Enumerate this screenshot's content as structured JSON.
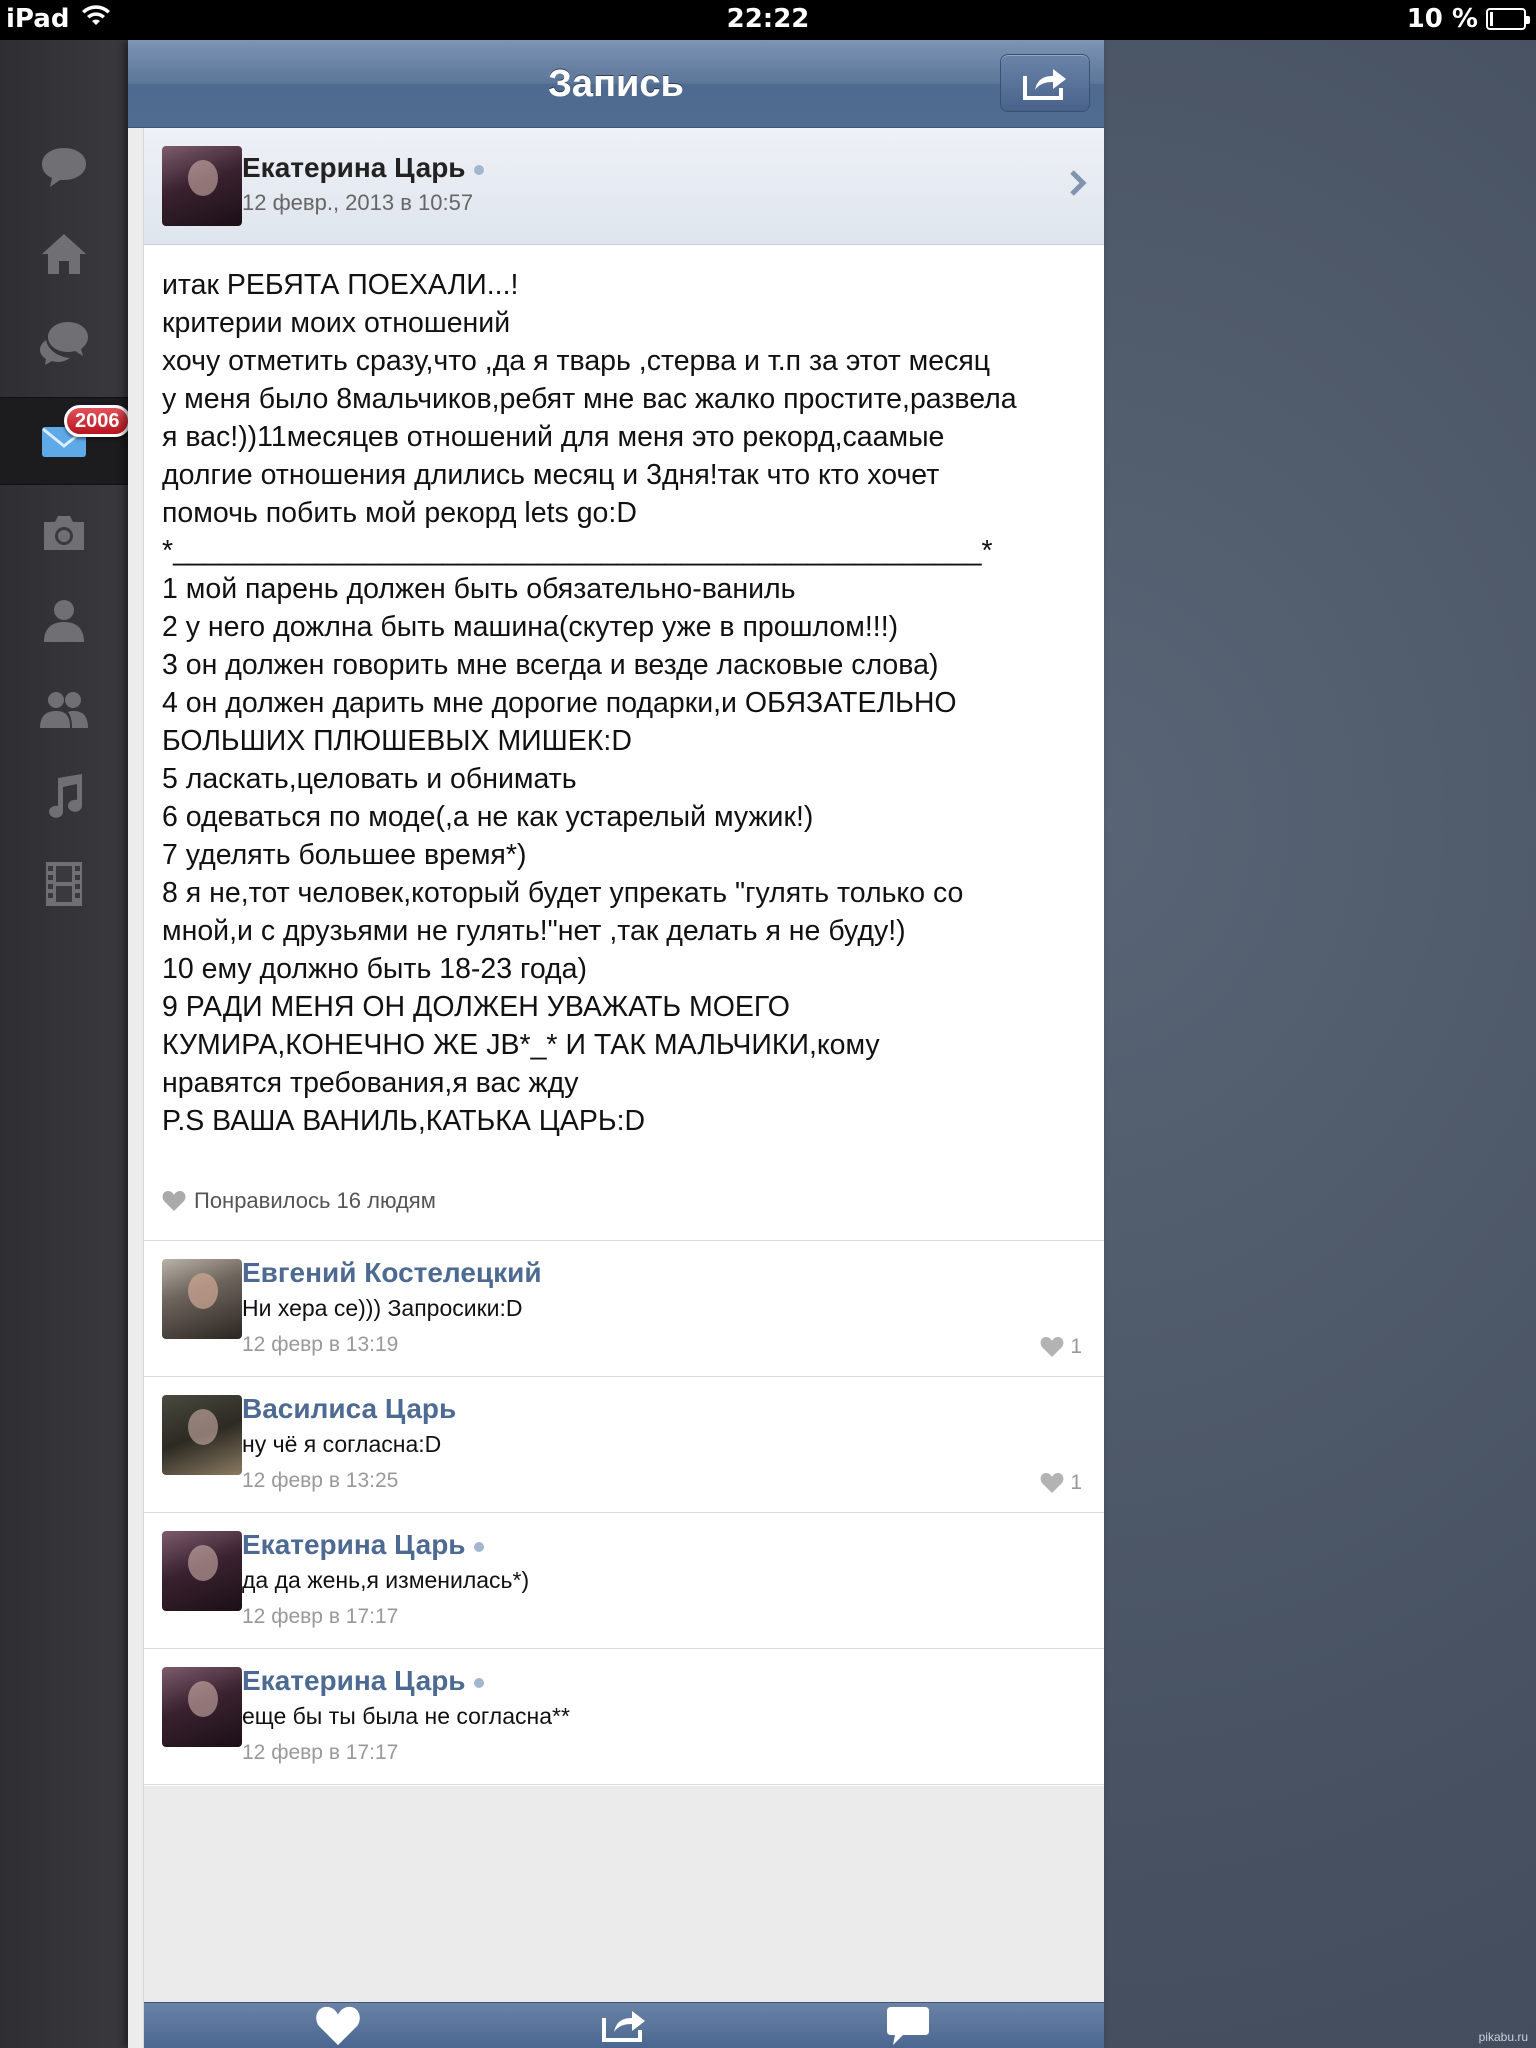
{
  "status_bar": {
    "device": "iPad",
    "time": "22:22",
    "battery": "10 %",
    "battery_level": 0.1
  },
  "sidebar": {
    "items": [
      {
        "icon": "speech-bubble-icon"
      },
      {
        "icon": "home-icon"
      },
      {
        "icon": "chat-bubbles-icon"
      },
      {
        "icon": "envelope-icon",
        "badge": "2006",
        "active": true
      },
      {
        "icon": "camera-icon"
      },
      {
        "icon": "person-icon"
      },
      {
        "icon": "friends-icon"
      },
      {
        "icon": "music-note-icon"
      },
      {
        "icon": "film-icon"
      }
    ]
  },
  "navbar": {
    "title": "Запись",
    "share_icon": "share-arrow-icon"
  },
  "post": {
    "author": "Екатерина Царь",
    "date": "12 февр., 2013 в 10:57",
    "text": "итак РЕБЯТА ПОЕХАЛИ...!\nкритерии моих отношений\nхочу отметить сразу,что ,да я тварь ,стерва и т.п за этот месяц\nу меня было 8мальчиков,ребят мне вас жалко простите,развела\nя вас!))11месяцев отношений для меня это   рекорд,саамые\nдолгие отношения длились  месяц и 3дня!так что кто хочет\nпомочь побить мой рекорд  lets go:D\n*___________________________________________________*\n1 мой парень должен быть обязательно-ваниль\n2  у него дожлна быть машина(скутер уже в прошлом!!!)\n3 он должен говорить мне всегда и везде ласковые слова)\n4 он должен дарить мне дорогие подарки,и ОБЯЗАТЕЛЬНО\nБОЛЬШИХ ПЛЮШЕВЫХ МИШЕК:D\n5 ласкать,целовать и обнимать\n6 одеваться по моде(,а не как устарелый мужик!)\n7 уделять большее время*)\n8 я не,тот человек,который будет упрекать \"гулять только со\nмной,и  с друзьями не гулять!\"нет ,так делать я  не буду!)\n10 ему должно быть 18-23 года)\n9 РАДИ МЕНЯ ОН ДОЛЖЕН УВАЖАТЬ МОЕГО\nКУМИРА,КОНЕЧНО ЖЕ   JB*_* И ТАК МАЛЬЧИКИ,кому\nнравятся требования,я вас жду\nP.S ВАША ВАНИЛЬ,КАТЬКА ЦАРЬ:D",
    "likes": "Понравилось 16 людям"
  },
  "comments": [
    {
      "name": "Евгений Костелецкий",
      "text": "Ни хера се))) Запросики:D",
      "time": "12 февр в 13:19",
      "likes": "1",
      "online": false
    },
    {
      "name": "Василиса Царь",
      "text": "ну чё я согласна:D",
      "time": "12 февр в 13:25",
      "likes": "1",
      "online": false
    },
    {
      "name": "Екатерина Царь",
      "text": "да да жень,я изменилась*)",
      "time": "12 февр в 17:17",
      "likes": "",
      "online": true
    },
    {
      "name": "Екатерина Царь",
      "text": "еще бы ты была не согласна**",
      "time": "12 февр в 17:17",
      "likes": "",
      "online": true
    }
  ],
  "toolbar": {
    "buttons": [
      "heart-icon",
      "repost-icon",
      "comment-icon"
    ]
  },
  "watermark": "pikabu.ru",
  "colors": {
    "navbar": "#5c7699",
    "link_name": "#4d6a92",
    "badge": "#c4161f"
  }
}
